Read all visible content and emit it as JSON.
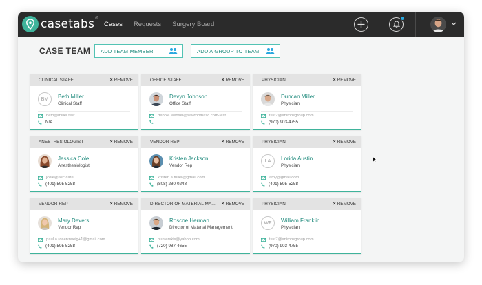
{
  "app": {
    "name": "casetabs",
    "reg_mark": "®"
  },
  "nav": [
    {
      "label": "Cases",
      "active": true
    },
    {
      "label": "Requests",
      "active": false
    },
    {
      "label": "Surgery Board",
      "active": false
    }
  ],
  "toolbar": {
    "add_icon": "plus-circle-icon",
    "notifications_icon": "bell-icon"
  },
  "page": {
    "title": "CASE TEAM",
    "add_member_label": "ADD TEAM MEMBER",
    "add_group_label": "ADD A GROUP TO TEAM"
  },
  "remove_label": "REMOVE",
  "cards": [
    {
      "role": "CLINICAL STAFF",
      "name": "Beth Miller",
      "title": "Clinical Staff",
      "email": "beth@miller.test",
      "phone": "N/A",
      "initials": "BM"
    },
    {
      "role": "OFFICE STAFF",
      "name": "Devyn Johnson",
      "title": "Office Staff",
      "email": "debbie.wensel@sawtoothasc.com-test",
      "phone": "",
      "initials": ""
    },
    {
      "role": "PHYSICIAN",
      "name": "Duncan Miller",
      "title": "Physician",
      "email": "test2@animosgroup.com",
      "phone": "(970) 903-4755",
      "initials": ""
    },
    {
      "role": "ANESTHESIOLOGIST",
      "name": "Jessica Cole",
      "title": "Anesthesiologist",
      "email": "jcole@asc.care",
      "phone": "(401) 595-5258",
      "initials": ""
    },
    {
      "role": "VENDOR REP",
      "name": "Kristen Jackson",
      "title": "Vendor Rep",
      "email": "kristen.a.fuller@gmail.com",
      "phone": "(808) 280-0248",
      "initials": ""
    },
    {
      "role": "PHYSICIAN",
      "name": "Lorida Austin",
      "title": "Physician",
      "email": "amy@gmail.com",
      "phone": "(401) 595-5258",
      "initials": "LA"
    },
    {
      "role": "VENDOR REP",
      "name": "Mary Devers",
      "title": "Vendor Rep",
      "email": "paul.a.rosenzweig+1@gmail.com",
      "phone": "(401) 595-5258",
      "initials": ""
    },
    {
      "role": "DIRECTOR OF MATERIAL MA...",
      "name": "Roscoe Herman",
      "title": "Director of Material Management",
      "email": "hunterskis@yahoo.com",
      "phone": "(720) 987-4655",
      "initials": ""
    },
    {
      "role": "PHYSICIAN",
      "name": "William Franklin",
      "title": "Physician",
      "email": "test7@animosgroup.com",
      "phone": "(970) 903-4755",
      "initials": "WF"
    }
  ],
  "colors": {
    "accent": "#3fb39b",
    "link": "#1e8a7c",
    "topbar": "#2b2b2b",
    "notification": "#29a8e0"
  }
}
